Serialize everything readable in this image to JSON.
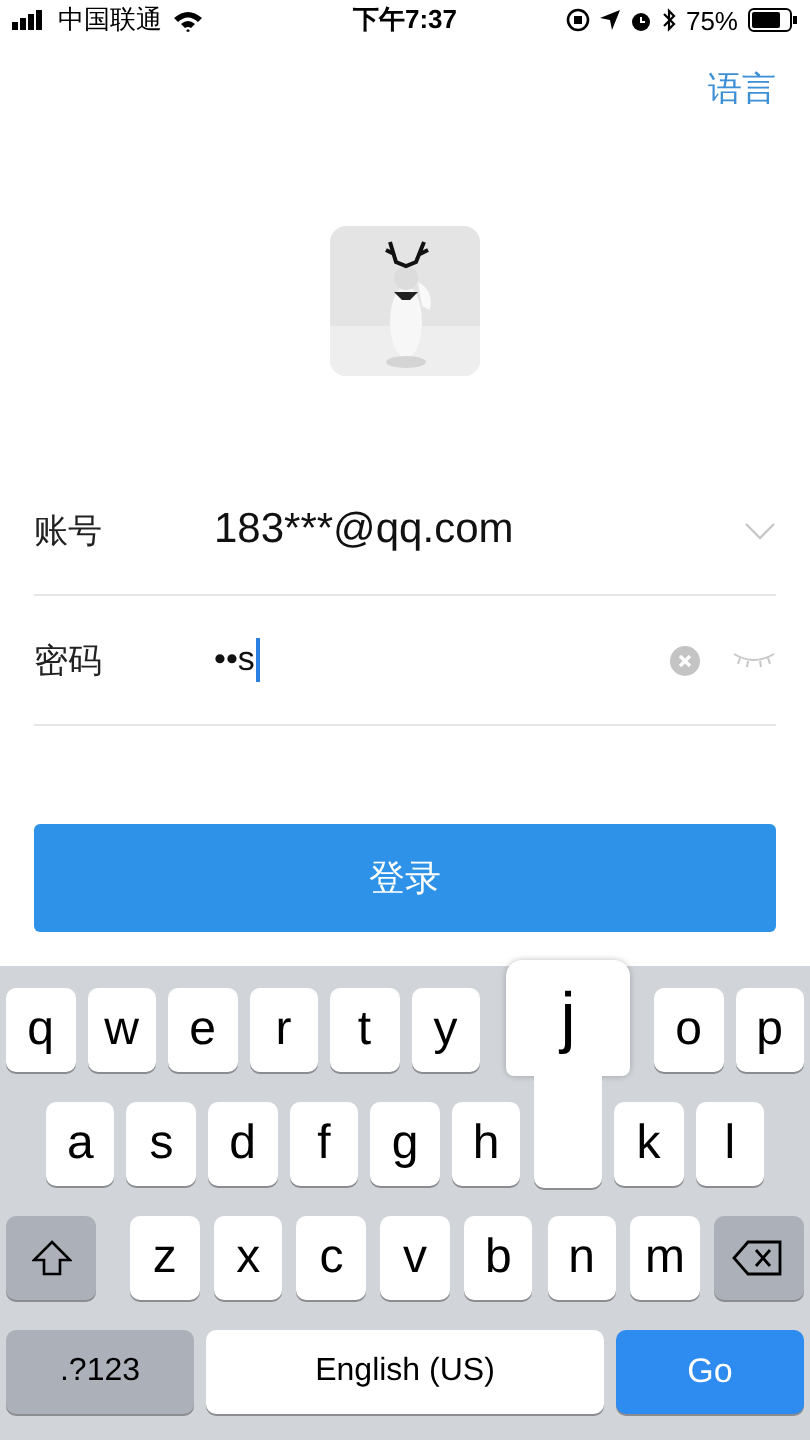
{
  "status_bar": {
    "carrier": "中国联通",
    "time": "下午7:37",
    "battery_text": "75%"
  },
  "header": {
    "language_link": "语言"
  },
  "form": {
    "fields": [
      {
        "label": "账号",
        "value": "183***@qq.com",
        "kind": "dropdown",
        "focused": false
      },
      {
        "label": "密码",
        "value": "••s",
        "kind": "password",
        "focused": true
      }
    ],
    "submit": "登录"
  },
  "keyboard": {
    "rows": [
      [
        {
          "label": "q"
        },
        {
          "label": "w"
        },
        {
          "label": "e"
        },
        {
          "label": "r"
        },
        {
          "label": "t"
        },
        {
          "label": "y"
        },
        {
          "kind": "covered"
        },
        {
          "kind": "covered"
        },
        {
          "label": "o"
        },
        {
          "label": "p"
        }
      ],
      [
        {
          "label": "a"
        },
        {
          "label": "s"
        },
        {
          "label": "d"
        },
        {
          "label": "f"
        },
        {
          "label": "g"
        },
        {
          "label": "h"
        },
        {
          "kind": "covered"
        },
        {
          "label": "k"
        },
        {
          "label": "l"
        }
      ],
      [
        {
          "kind": "shift"
        },
        {
          "label": "z"
        },
        {
          "label": "x"
        },
        {
          "label": "c"
        },
        {
          "label": "v"
        },
        {
          "label": "b"
        },
        {
          "label": "n"
        },
        {
          "label": "m"
        },
        {
          "kind": "delete"
        }
      ]
    ],
    "numbers_key": ".?123",
    "space_key": "English (US)",
    "go_key": "Go",
    "pressed_key_popup": "j"
  }
}
